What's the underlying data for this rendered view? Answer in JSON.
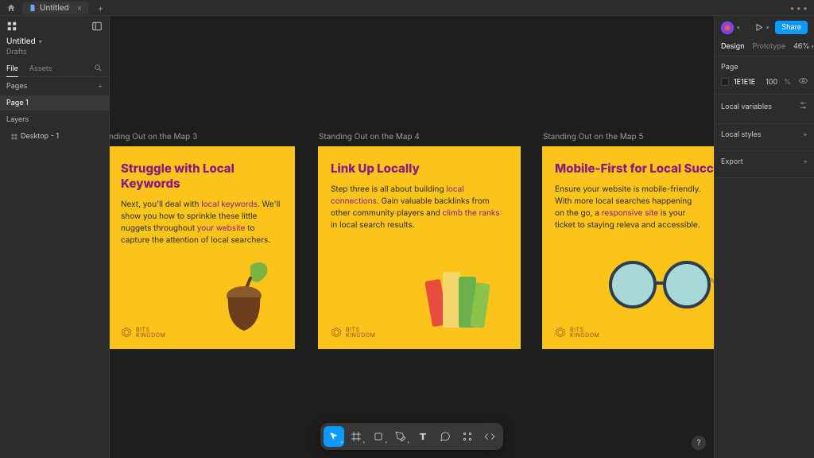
{
  "titlebar": {
    "tab_name": "Untitled",
    "menu_dots": "•••"
  },
  "left": {
    "file_name": "Untitled",
    "location": "Drafts",
    "tabs": {
      "file": "File",
      "assets": "Assets"
    },
    "pages_header": "Pages",
    "pages": {
      "page1": "Page 1"
    },
    "layers_header": "Layers",
    "layers": {
      "desktop1": "Desktop - 1"
    }
  },
  "canvas": {
    "frames": [
      {
        "label": "nding Out on the Map 3",
        "title": "Struggle with Local Keywords",
        "body_parts": [
          "Next, you'll deal with ",
          "local keywords",
          ". We'll show you how to sprinkle these little nuggets throughout ",
          "your website",
          " to capture the attention of local searchers."
        ],
        "logo": "BITS\nKINGDOM"
      },
      {
        "label": "Standing Out on the Map 4",
        "title": "Link Up Locally",
        "body_parts": [
          "Step three is all about building ",
          "local connections",
          ". Gain valuable backlinks from other community players and ",
          "climb the ranks",
          " in local search results."
        ],
        "logo": "BITS\nKINGDOM"
      },
      {
        "label": "Standing Out on the Map 5",
        "title": "Mobile-First for Local Succe",
        "body_parts": [
          "Ensure your website is mobile-friendly. With more local searches happening on the go, a ",
          "responsive site",
          " is your ticket to staying releva and accessible.",
          ""
        ],
        "logo": "BITS\nKINGDOM"
      }
    ]
  },
  "right": {
    "share": "Share",
    "tabs": {
      "design": "Design",
      "prototype": "Prototype"
    },
    "zoom": "46%",
    "page_section": "Page",
    "bg_hex": "1E1E1E",
    "bg_pct": "100",
    "bg_unit": "%",
    "local_vars": "Local variables",
    "local_styles": "Local styles",
    "export": "Export"
  },
  "help": "?"
}
